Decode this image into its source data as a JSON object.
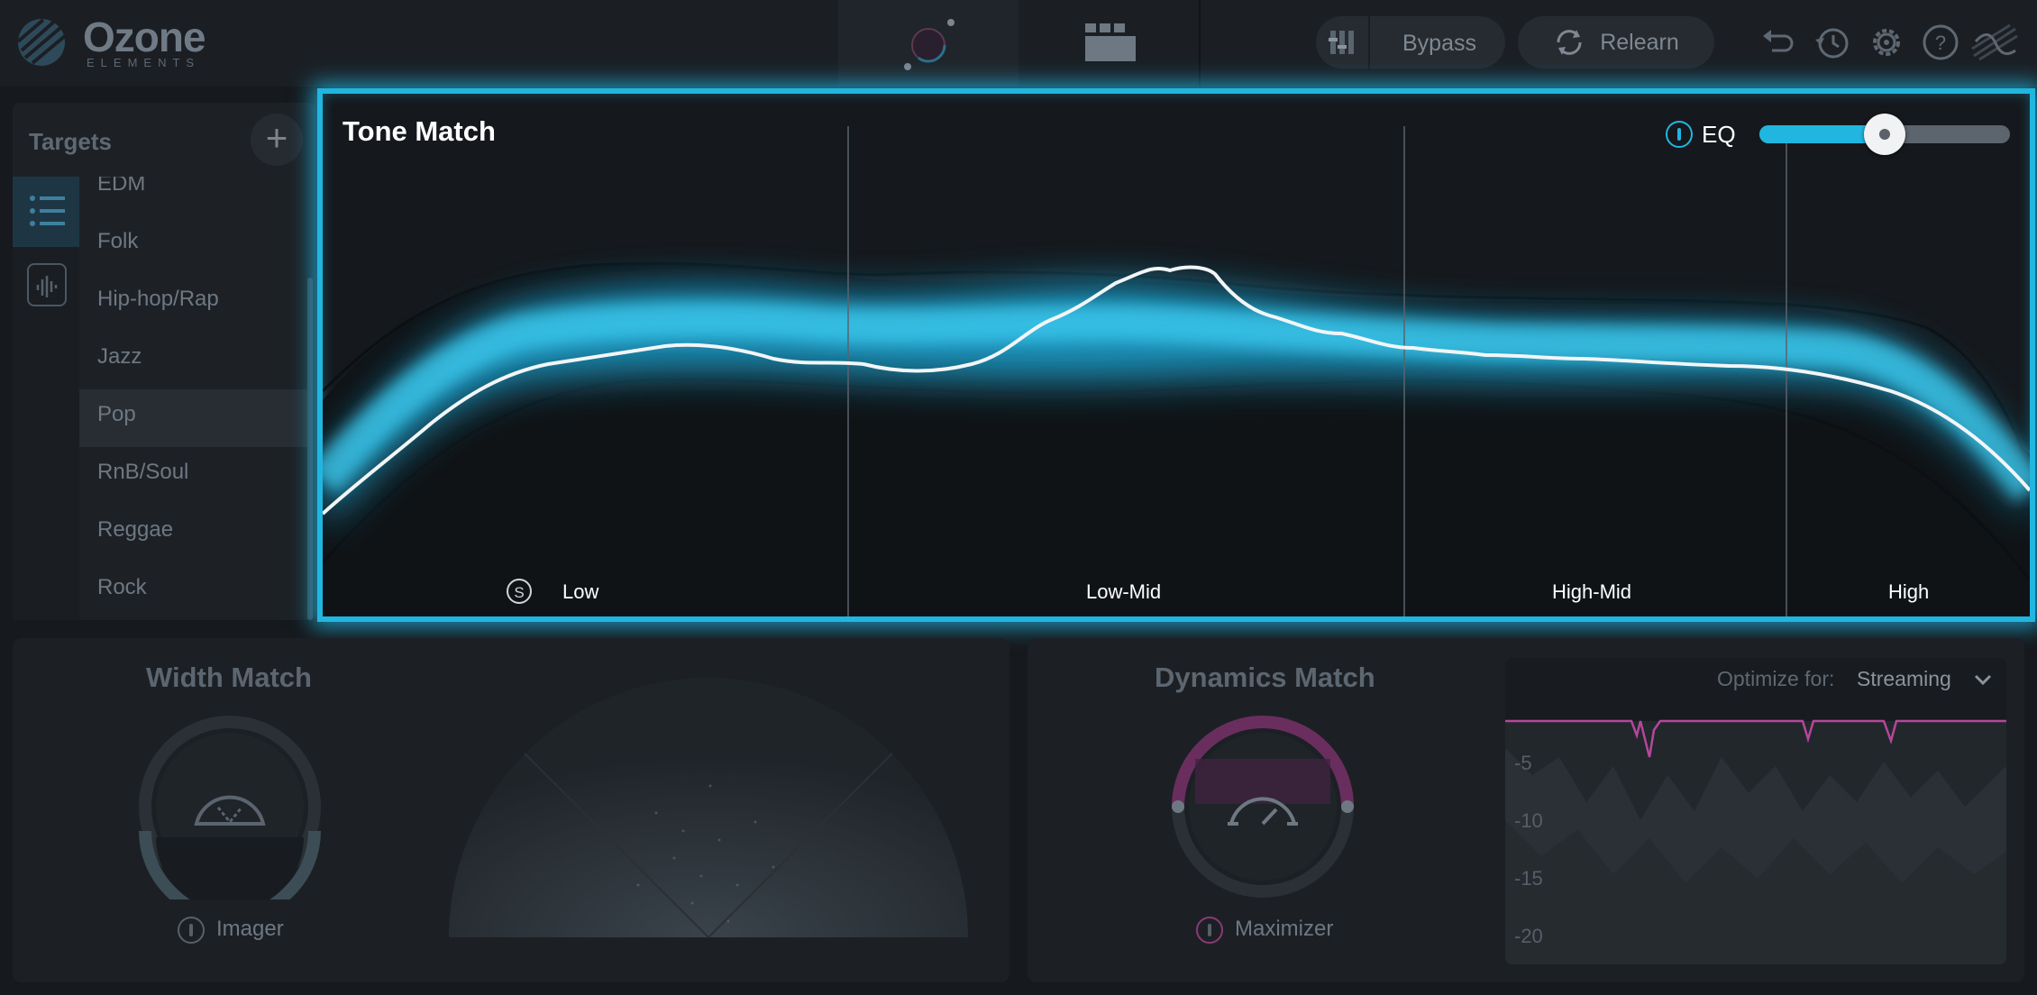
{
  "app": {
    "logo": "Ozone",
    "logo_sub": "ELEMENTS"
  },
  "header": {
    "bypass_label": "Bypass",
    "relearn_label": "Relearn"
  },
  "targets": {
    "title": "Targets",
    "items": [
      {
        "label": "EDM",
        "selected": false
      },
      {
        "label": "Folk",
        "selected": false
      },
      {
        "label": "Hip-hop/Rap",
        "selected": false
      },
      {
        "label": "Jazz",
        "selected": false
      },
      {
        "label": "Pop",
        "selected": true
      },
      {
        "label": "RnB/Soul",
        "selected": false
      },
      {
        "label": "Reggae",
        "selected": false
      },
      {
        "label": "Rock",
        "selected": false
      }
    ]
  },
  "tone_match": {
    "title": "Tone Match",
    "eq_label": "EQ",
    "eq_amount_fraction": 0.5,
    "solo_label": "S",
    "bands": [
      "Low",
      "Low-Mid",
      "High-Mid",
      "High"
    ],
    "accent": "#21b6e0"
  },
  "width_match": {
    "title": "Width Match",
    "module_label": "Imager"
  },
  "dynamics_match": {
    "title": "Dynamics Match",
    "module_label": "Maximizer",
    "optimize_label": "Optimize for:",
    "optimize_value": "Streaming",
    "db_ticks": [
      "-5",
      "-10",
      "-15",
      "-20"
    ],
    "accent": "#c24fa0"
  }
}
